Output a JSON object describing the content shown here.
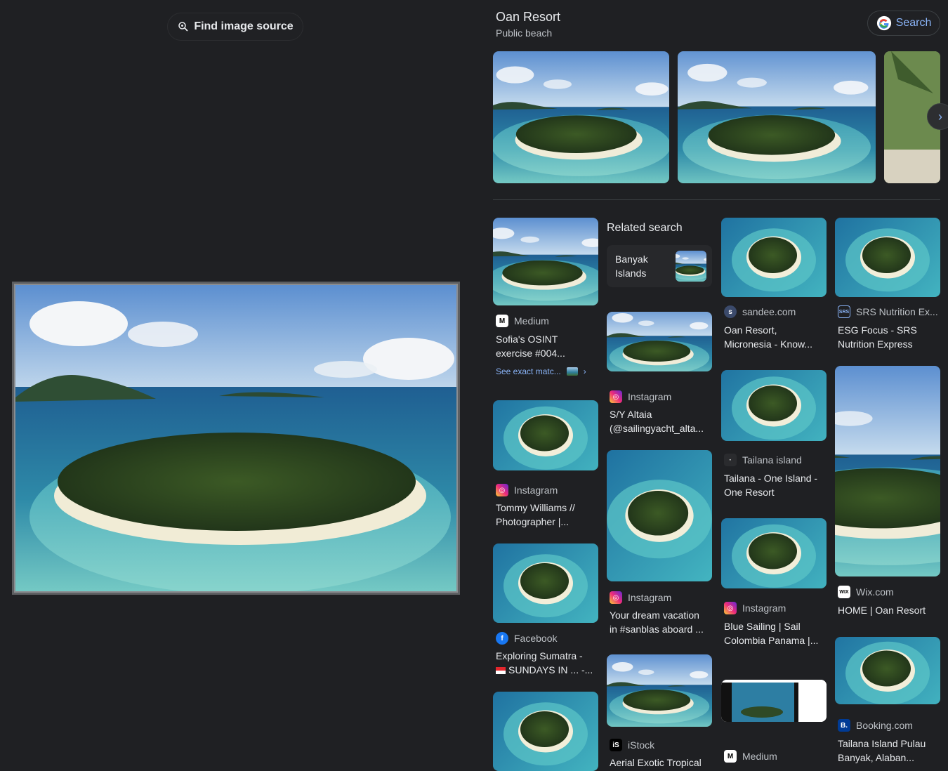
{
  "left_panel": {
    "find_source_label": "Find image source"
  },
  "header": {
    "title": "Oan Resort",
    "subtitle": "Public beach",
    "search_label": "Search"
  },
  "related_search": {
    "title": "Related search",
    "item_line1": "Banyak",
    "item_line2": "Islands"
  },
  "results": [
    {
      "source": "Medium",
      "line1": "Sofia's OSINT",
      "line2": "exercise #004..."
    },
    {
      "source": "Instagram",
      "line1": "Tommy Williams //",
      "line2": "Photographer |..."
    },
    {
      "source": "Facebook",
      "line1": "Exploring Sumatra -",
      "line2": "SUNDAYS IN ... -..."
    },
    {
      "source": "Instagram",
      "line1": "S/Y Altaia",
      "line2": "(@sailingyacht_alta..."
    },
    {
      "source": "Instagram",
      "line1": "Your dream vacation",
      "line2": "in #sanblas aboard ..."
    },
    {
      "source": "iStock",
      "line1": "Aerial Exotic Tropical",
      "line2": ""
    },
    {
      "source": "sandee.com",
      "line1": "Oan Resort,",
      "line2": "Micronesia - Know..."
    },
    {
      "source": "Tailana island",
      "line1": "Tailana - One Island -",
      "line2": "One Resort"
    },
    {
      "source": "Instagram",
      "line1": "Blue Sailing | Sail",
      "line2": "Colombia Panama |..."
    },
    {
      "source": "Medium",
      "line1": "",
      "line2": ""
    },
    {
      "source": "SRS Nutrition Ex...",
      "line1": "ESG Focus - SRS",
      "line2": "Nutrition Express"
    },
    {
      "source": "Wix.com",
      "line1": "HOME | Oan Resort",
      "line2": ""
    },
    {
      "source": "Booking.com",
      "line1": "Tailana Island Pulau",
      "line2": "Banyak, Alaban..."
    }
  ],
  "exact_match_label": "See exact matc...",
  "icons": {
    "find_source": "lens-search-icon",
    "google": "google-g-icon",
    "next": "chevron-right-icon"
  },
  "colors": {
    "background": "#1f2023",
    "link": "#8ab4f8"
  }
}
